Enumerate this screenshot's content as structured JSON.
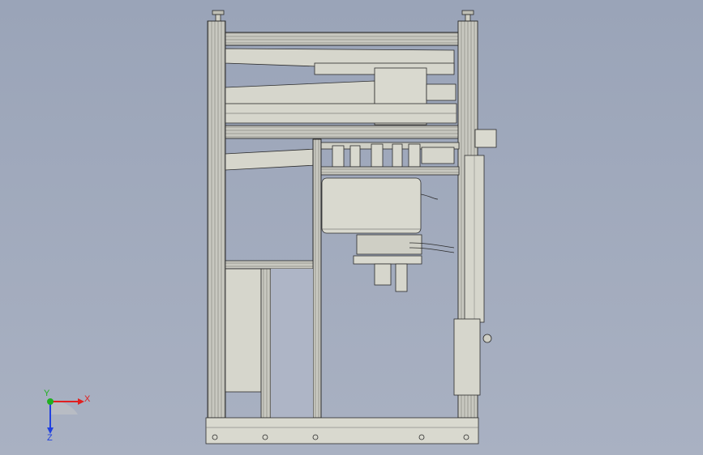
{
  "viewport": {
    "background_top": "#9aa4b8",
    "background_bottom": "#a9b1c2"
  },
  "model": {
    "frame_color": "#d9d9cf",
    "frame_edge": "#2b2b2b",
    "panel_color": "#d6d6cc"
  },
  "triad": {
    "x_label": "X",
    "y_label": "Y",
    "z_label": "Z",
    "x_color": "#e02020",
    "y_color": "#20b020",
    "z_color": "#2040e0"
  }
}
